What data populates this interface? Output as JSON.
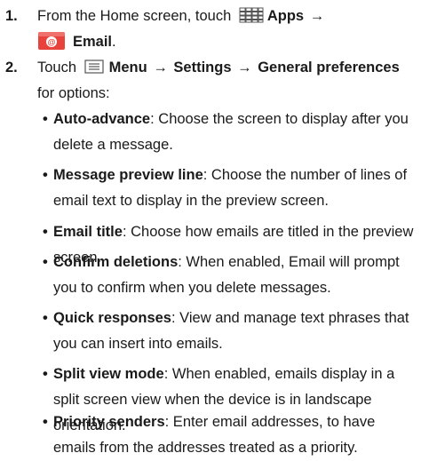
{
  "steps": [
    {
      "number": "1.",
      "line1_prefix": "From the Home screen, touch",
      "apps_icon": "apps-grid-icon",
      "apps_label": "Apps",
      "arrow": "→",
      "email_icon": "email-app-icon",
      "email_label": "Email",
      "end": "."
    },
    {
      "number": "2.",
      "touch": "Touch",
      "menu_icon": "menu-icon",
      "menu_label": "Menu",
      "arrow": "→",
      "settings_label": "Settings",
      "general_label": "General preferences",
      "suffix": "for options:"
    }
  ],
  "bullets": [
    {
      "term": "Auto-advance",
      "desc": ": Choose the screen to display after you delete a message."
    },
    {
      "term": "Message preview line",
      "desc": ": Choose the number of lines of email text to display in the preview screen."
    },
    {
      "term": "Email title",
      "desc": ": Choose how emails are titled in the preview screen."
    },
    {
      "term": "Confirm deletions",
      "desc": ": When enabled, Email will prompt you to confirm when you delete messages."
    },
    {
      "term": "Quick responses",
      "desc": ": View and manage text phrases that you can insert into emails."
    },
    {
      "term": "Split view mode",
      "desc": ": When enabled, emails display in a split screen view when the device is in landscape orientation."
    },
    {
      "term": "Priority senders",
      "desc": ": Enter email addresses, to have emails from the addresses treated as a priority."
    }
  ],
  "colors": {
    "text": "#1a1a1a",
    "email_icon_bg": "#e8423c"
  }
}
